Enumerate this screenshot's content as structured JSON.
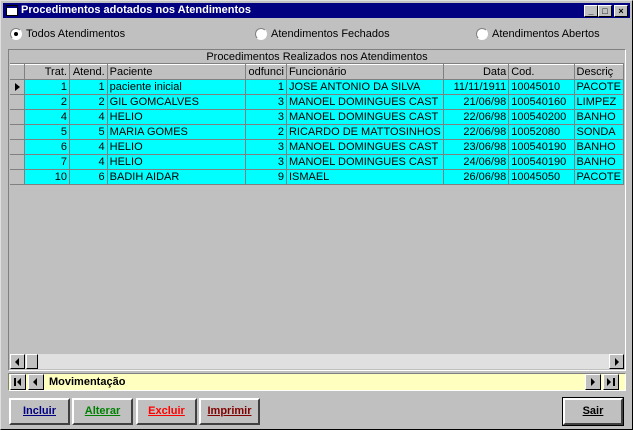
{
  "window": {
    "title": "Procedimentos adotados nos Atendimentos",
    "controls": [
      "_",
      "□",
      "×"
    ]
  },
  "filters": [
    {
      "label": "Todos Atendimentos",
      "checked": true
    },
    {
      "label": "Atendimentos Fechados",
      "checked": false
    },
    {
      "label": "Atendimentos Abertos",
      "checked": false
    }
  ],
  "grid": {
    "caption": "Procedimentos Realizados nos Atendimentos",
    "columns": [
      "Trat.",
      "Atend.",
      "Paciente",
      "odfunci",
      "Funcionário",
      "Data",
      "Cod.",
      "Descriç"
    ],
    "rows": [
      {
        "trat": "1",
        "atend": "1",
        "paciente": "paciente inicial",
        "odfunci": "1",
        "funcionario": "JOSE ANTONIO DA SILVA",
        "data": "11/11/1911",
        "cod": "10045010",
        "descr": "PACOTE"
      },
      {
        "trat": "2",
        "atend": "2",
        "paciente": "GIL GOMCALVES",
        "odfunci": "3",
        "funcionario": "MANOEL DOMINGUES  CAST",
        "data": "21/06/98",
        "cod": "100540160",
        "descr": "LIMPEZ"
      },
      {
        "trat": "4",
        "atend": "4",
        "paciente": "HELIO",
        "odfunci": "3",
        "funcionario": "MANOEL DOMINGUES  CAST",
        "data": "22/06/98",
        "cod": "100540200",
        "descr": "BANHO"
      },
      {
        "trat": "5",
        "atend": "5",
        "paciente": "MARIA GOMES",
        "odfunci": "2",
        "funcionario": "RICARDO DE MATTOSINHOS",
        "data": "22/06/98",
        "cod": "10052080",
        "descr": "SONDA"
      },
      {
        "trat": "6",
        "atend": "4",
        "paciente": "HELIO",
        "odfunci": "3",
        "funcionario": "MANOEL DOMINGUES  CAST",
        "data": "23/06/98",
        "cod": "100540190",
        "descr": "BANHO"
      },
      {
        "trat": "7",
        "atend": "4",
        "paciente": "HELIO",
        "odfunci": "3",
        "funcionario": "MANOEL DOMINGUES  CAST",
        "data": "24/06/98",
        "cod": "100540190",
        "descr": "BANHO"
      },
      {
        "trat": "10",
        "atend": "6",
        "paciente": "BADIH AIDAR",
        "odfunci": "9",
        "funcionario": "ISMAEL",
        "data": "26/06/98",
        "cod": "10045050",
        "descr": "PACOTE"
      }
    ],
    "row_color": "#00ffff"
  },
  "navigator": {
    "caption": "Movimentação",
    "background": "#ffffc0"
  },
  "buttons": {
    "incluir": "Incluir",
    "alterar": "Alterar",
    "excluir": "Excluir",
    "imprimir": "Imprimir",
    "sair": "Sair",
    "colors": {
      "incluir": "#000080",
      "alterar": "#008000",
      "excluir": "#ff0000",
      "imprimir": "#800000",
      "sair": "#000000"
    }
  }
}
